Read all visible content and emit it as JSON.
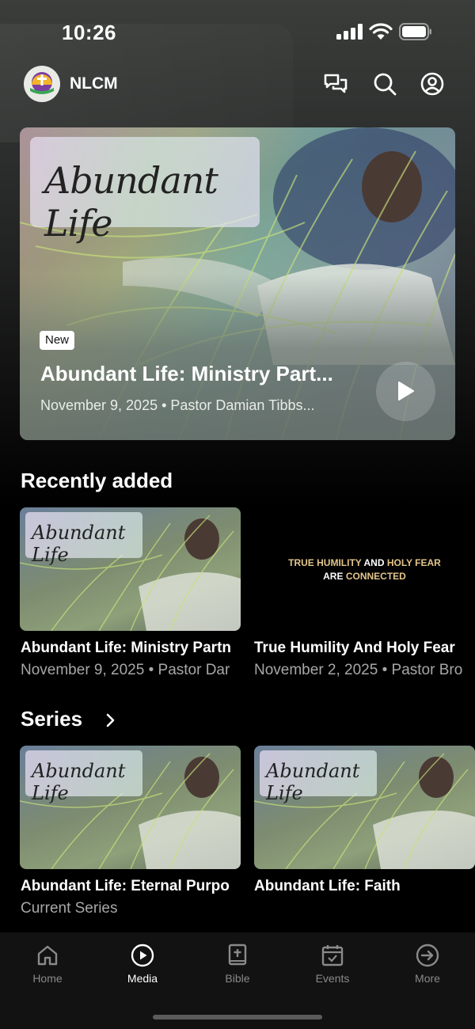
{
  "status_bar": {
    "time": "10:26"
  },
  "header": {
    "brand": "NLCM"
  },
  "hero": {
    "art_text": "Abundant Life",
    "badge": "New",
    "title": "Abundant Life: Ministry Part...",
    "meta": "November 9, 2025 • Pastor Damian Tibbs..."
  },
  "recently_added": {
    "title": "Recently added",
    "items": [
      {
        "art_text": "Abundant Life",
        "title": "Abundant Life: Ministry Partn",
        "meta": "November 9, 2025 • Pastor Dar"
      },
      {
        "art_line1_a": "TRUE HUMILITY",
        "art_line1_b": "AND",
        "art_line1_c": "HOLY FEAR",
        "art_line2_a": "ARE",
        "art_line2_b": "CONNECTED",
        "title": "True Humility And Holy Fear",
        "meta": "November 2, 2025 • Pastor Bro"
      }
    ]
  },
  "series": {
    "title": "Series",
    "items": [
      {
        "art_text": "Abundant Life",
        "title": "Abundant Life: Eternal Purpo",
        "meta": "Current Series"
      },
      {
        "art_text": "Abundant Life",
        "title": "Abundant Life: Faith",
        "meta": ""
      }
    ]
  },
  "tabs": [
    {
      "label": "Home",
      "icon": "home-icon",
      "active": false
    },
    {
      "label": "Media",
      "icon": "play-circle-icon",
      "active": true
    },
    {
      "label": "Bible",
      "icon": "bible-icon",
      "active": false
    },
    {
      "label": "Events",
      "icon": "calendar-icon",
      "active": false
    },
    {
      "label": "More",
      "icon": "arrow-circle-icon",
      "active": false
    }
  ],
  "colors": {
    "accent_gold": "#e2c58a",
    "tab_inactive": "#8a8a8a",
    "subtitle_gray": "#a7a7a7"
  }
}
